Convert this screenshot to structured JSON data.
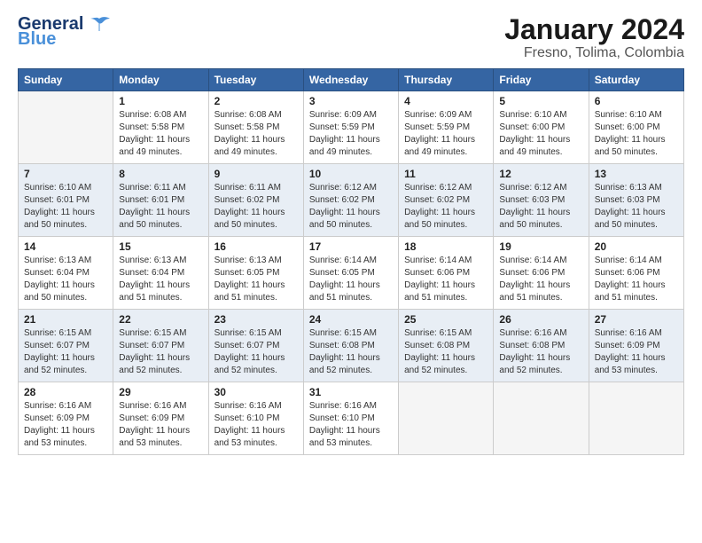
{
  "logo": {
    "text1": "General",
    "text2": "Blue",
    "bird_symbol": "🐦"
  },
  "title": "January 2024",
  "subtitle": "Fresno, Tolima, Colombia",
  "days_header": [
    "Sunday",
    "Monday",
    "Tuesday",
    "Wednesday",
    "Thursday",
    "Friday",
    "Saturday"
  ],
  "weeks": [
    {
      "days": [
        {
          "num": "",
          "info": ""
        },
        {
          "num": "1",
          "info": "Sunrise: 6:08 AM\nSunset: 5:58 PM\nDaylight: 11 hours\nand 49 minutes."
        },
        {
          "num": "2",
          "info": "Sunrise: 6:08 AM\nSunset: 5:58 PM\nDaylight: 11 hours\nand 49 minutes."
        },
        {
          "num": "3",
          "info": "Sunrise: 6:09 AM\nSunset: 5:59 PM\nDaylight: 11 hours\nand 49 minutes."
        },
        {
          "num": "4",
          "info": "Sunrise: 6:09 AM\nSunset: 5:59 PM\nDaylight: 11 hours\nand 49 minutes."
        },
        {
          "num": "5",
          "info": "Sunrise: 6:10 AM\nSunset: 6:00 PM\nDaylight: 11 hours\nand 49 minutes."
        },
        {
          "num": "6",
          "info": "Sunrise: 6:10 AM\nSunset: 6:00 PM\nDaylight: 11 hours\nand 50 minutes."
        }
      ]
    },
    {
      "days": [
        {
          "num": "7",
          "info": "Sunrise: 6:10 AM\nSunset: 6:01 PM\nDaylight: 11 hours\nand 50 minutes."
        },
        {
          "num": "8",
          "info": "Sunrise: 6:11 AM\nSunset: 6:01 PM\nDaylight: 11 hours\nand 50 minutes."
        },
        {
          "num": "9",
          "info": "Sunrise: 6:11 AM\nSunset: 6:02 PM\nDaylight: 11 hours\nand 50 minutes."
        },
        {
          "num": "10",
          "info": "Sunrise: 6:12 AM\nSunset: 6:02 PM\nDaylight: 11 hours\nand 50 minutes."
        },
        {
          "num": "11",
          "info": "Sunrise: 6:12 AM\nSunset: 6:02 PM\nDaylight: 11 hours\nand 50 minutes."
        },
        {
          "num": "12",
          "info": "Sunrise: 6:12 AM\nSunset: 6:03 PM\nDaylight: 11 hours\nand 50 minutes."
        },
        {
          "num": "13",
          "info": "Sunrise: 6:13 AM\nSunset: 6:03 PM\nDaylight: 11 hours\nand 50 minutes."
        }
      ]
    },
    {
      "days": [
        {
          "num": "14",
          "info": "Sunrise: 6:13 AM\nSunset: 6:04 PM\nDaylight: 11 hours\nand 50 minutes."
        },
        {
          "num": "15",
          "info": "Sunrise: 6:13 AM\nSunset: 6:04 PM\nDaylight: 11 hours\nand 51 minutes."
        },
        {
          "num": "16",
          "info": "Sunrise: 6:13 AM\nSunset: 6:05 PM\nDaylight: 11 hours\nand 51 minutes."
        },
        {
          "num": "17",
          "info": "Sunrise: 6:14 AM\nSunset: 6:05 PM\nDaylight: 11 hours\nand 51 minutes."
        },
        {
          "num": "18",
          "info": "Sunrise: 6:14 AM\nSunset: 6:06 PM\nDaylight: 11 hours\nand 51 minutes."
        },
        {
          "num": "19",
          "info": "Sunrise: 6:14 AM\nSunset: 6:06 PM\nDaylight: 11 hours\nand 51 minutes."
        },
        {
          "num": "20",
          "info": "Sunrise: 6:14 AM\nSunset: 6:06 PM\nDaylight: 11 hours\nand 51 minutes."
        }
      ]
    },
    {
      "days": [
        {
          "num": "21",
          "info": "Sunrise: 6:15 AM\nSunset: 6:07 PM\nDaylight: 11 hours\nand 52 minutes."
        },
        {
          "num": "22",
          "info": "Sunrise: 6:15 AM\nSunset: 6:07 PM\nDaylight: 11 hours\nand 52 minutes."
        },
        {
          "num": "23",
          "info": "Sunrise: 6:15 AM\nSunset: 6:07 PM\nDaylight: 11 hours\nand 52 minutes."
        },
        {
          "num": "24",
          "info": "Sunrise: 6:15 AM\nSunset: 6:08 PM\nDaylight: 11 hours\nand 52 minutes."
        },
        {
          "num": "25",
          "info": "Sunrise: 6:15 AM\nSunset: 6:08 PM\nDaylight: 11 hours\nand 52 minutes."
        },
        {
          "num": "26",
          "info": "Sunrise: 6:16 AM\nSunset: 6:08 PM\nDaylight: 11 hours\nand 52 minutes."
        },
        {
          "num": "27",
          "info": "Sunrise: 6:16 AM\nSunset: 6:09 PM\nDaylight: 11 hours\nand 53 minutes."
        }
      ]
    },
    {
      "days": [
        {
          "num": "28",
          "info": "Sunrise: 6:16 AM\nSunset: 6:09 PM\nDaylight: 11 hours\nand 53 minutes."
        },
        {
          "num": "29",
          "info": "Sunrise: 6:16 AM\nSunset: 6:09 PM\nDaylight: 11 hours\nand 53 minutes."
        },
        {
          "num": "30",
          "info": "Sunrise: 6:16 AM\nSunset: 6:10 PM\nDaylight: 11 hours\nand 53 minutes."
        },
        {
          "num": "31",
          "info": "Sunrise: 6:16 AM\nSunset: 6:10 PM\nDaylight: 11 hours\nand 53 minutes."
        },
        {
          "num": "",
          "info": ""
        },
        {
          "num": "",
          "info": ""
        },
        {
          "num": "",
          "info": ""
        }
      ]
    }
  ]
}
